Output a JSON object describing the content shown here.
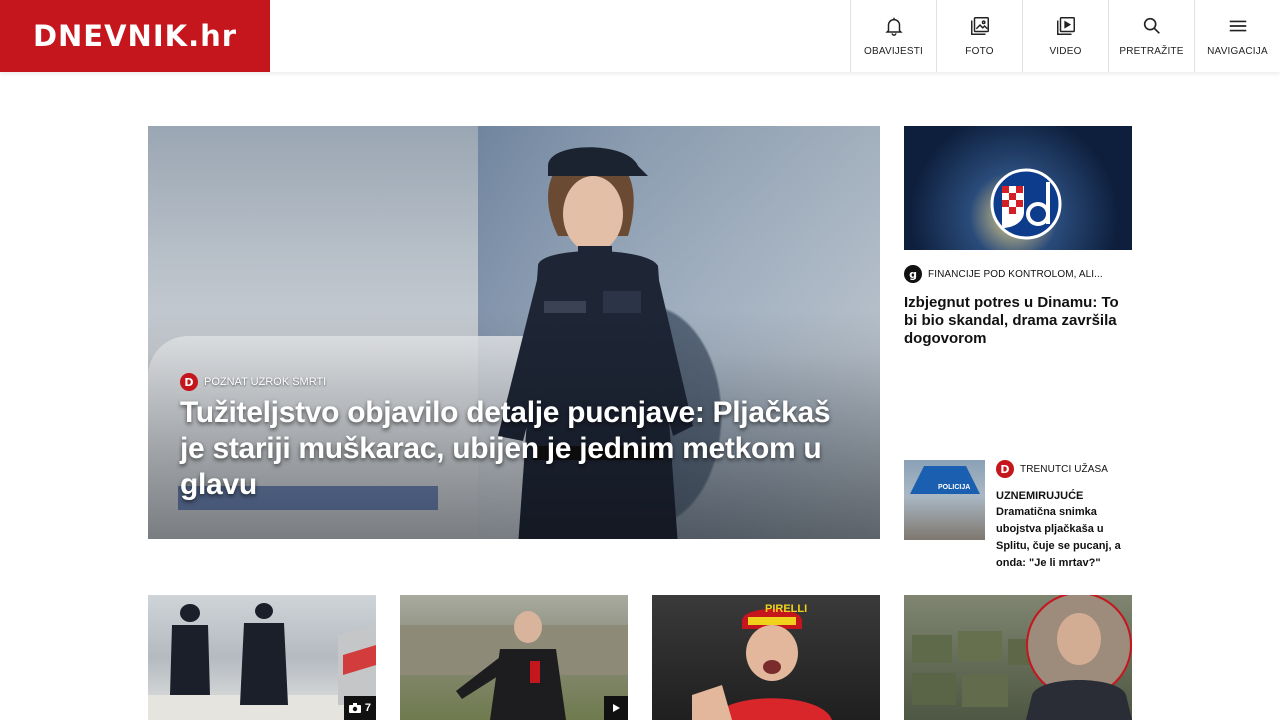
{
  "brand": {
    "logo_text": "DNEVNIK.hr",
    "color": "#c5161d"
  },
  "nav": [
    {
      "label": "OBAVIJESTI",
      "icon": "bell-icon"
    },
    {
      "label": "FOTO",
      "icon": "photo-gallery-icon"
    },
    {
      "label": "VIDEO",
      "icon": "video-play-icon"
    },
    {
      "label": "PRETRAŽITE",
      "icon": "search-icon"
    },
    {
      "label": "NAVIGACIJA",
      "icon": "menu-icon"
    }
  ],
  "hero": {
    "kicker": "POZNAT UZROK SMRTI",
    "kicker_icon": "D",
    "title": "Tužiteljstvo objavilo detalje pucnjave: Pljačkaš je stariji muškarac, ubijen je jednim metkom u glavu"
  },
  "side_top": {
    "kicker_icon": "g",
    "kicker": "FINANCIJE POD KONTROLOM, ALI...",
    "title": "Izbjegnut potres u Dinamu: To bi bio skandal, drama završila dogovorom"
  },
  "side_small": {
    "kicker_icon": "D",
    "kicker": "TRENUTCI UŽASA",
    "upper": "UZNEMIRUJUĆE",
    "title": "Dramatična snimka ubojstva pljačkaša u Splitu, čuje se pucanj, a onda: \"Je li mrtav?\"",
    "image_label": "POLICIJA"
  },
  "bottom_cards": [
    {
      "badge": "7",
      "badge_icon": "camera-icon"
    },
    {
      "badge_icon": "play-icon"
    },
    {
      "sponsor_text": "PIRELLI"
    },
    {}
  ]
}
